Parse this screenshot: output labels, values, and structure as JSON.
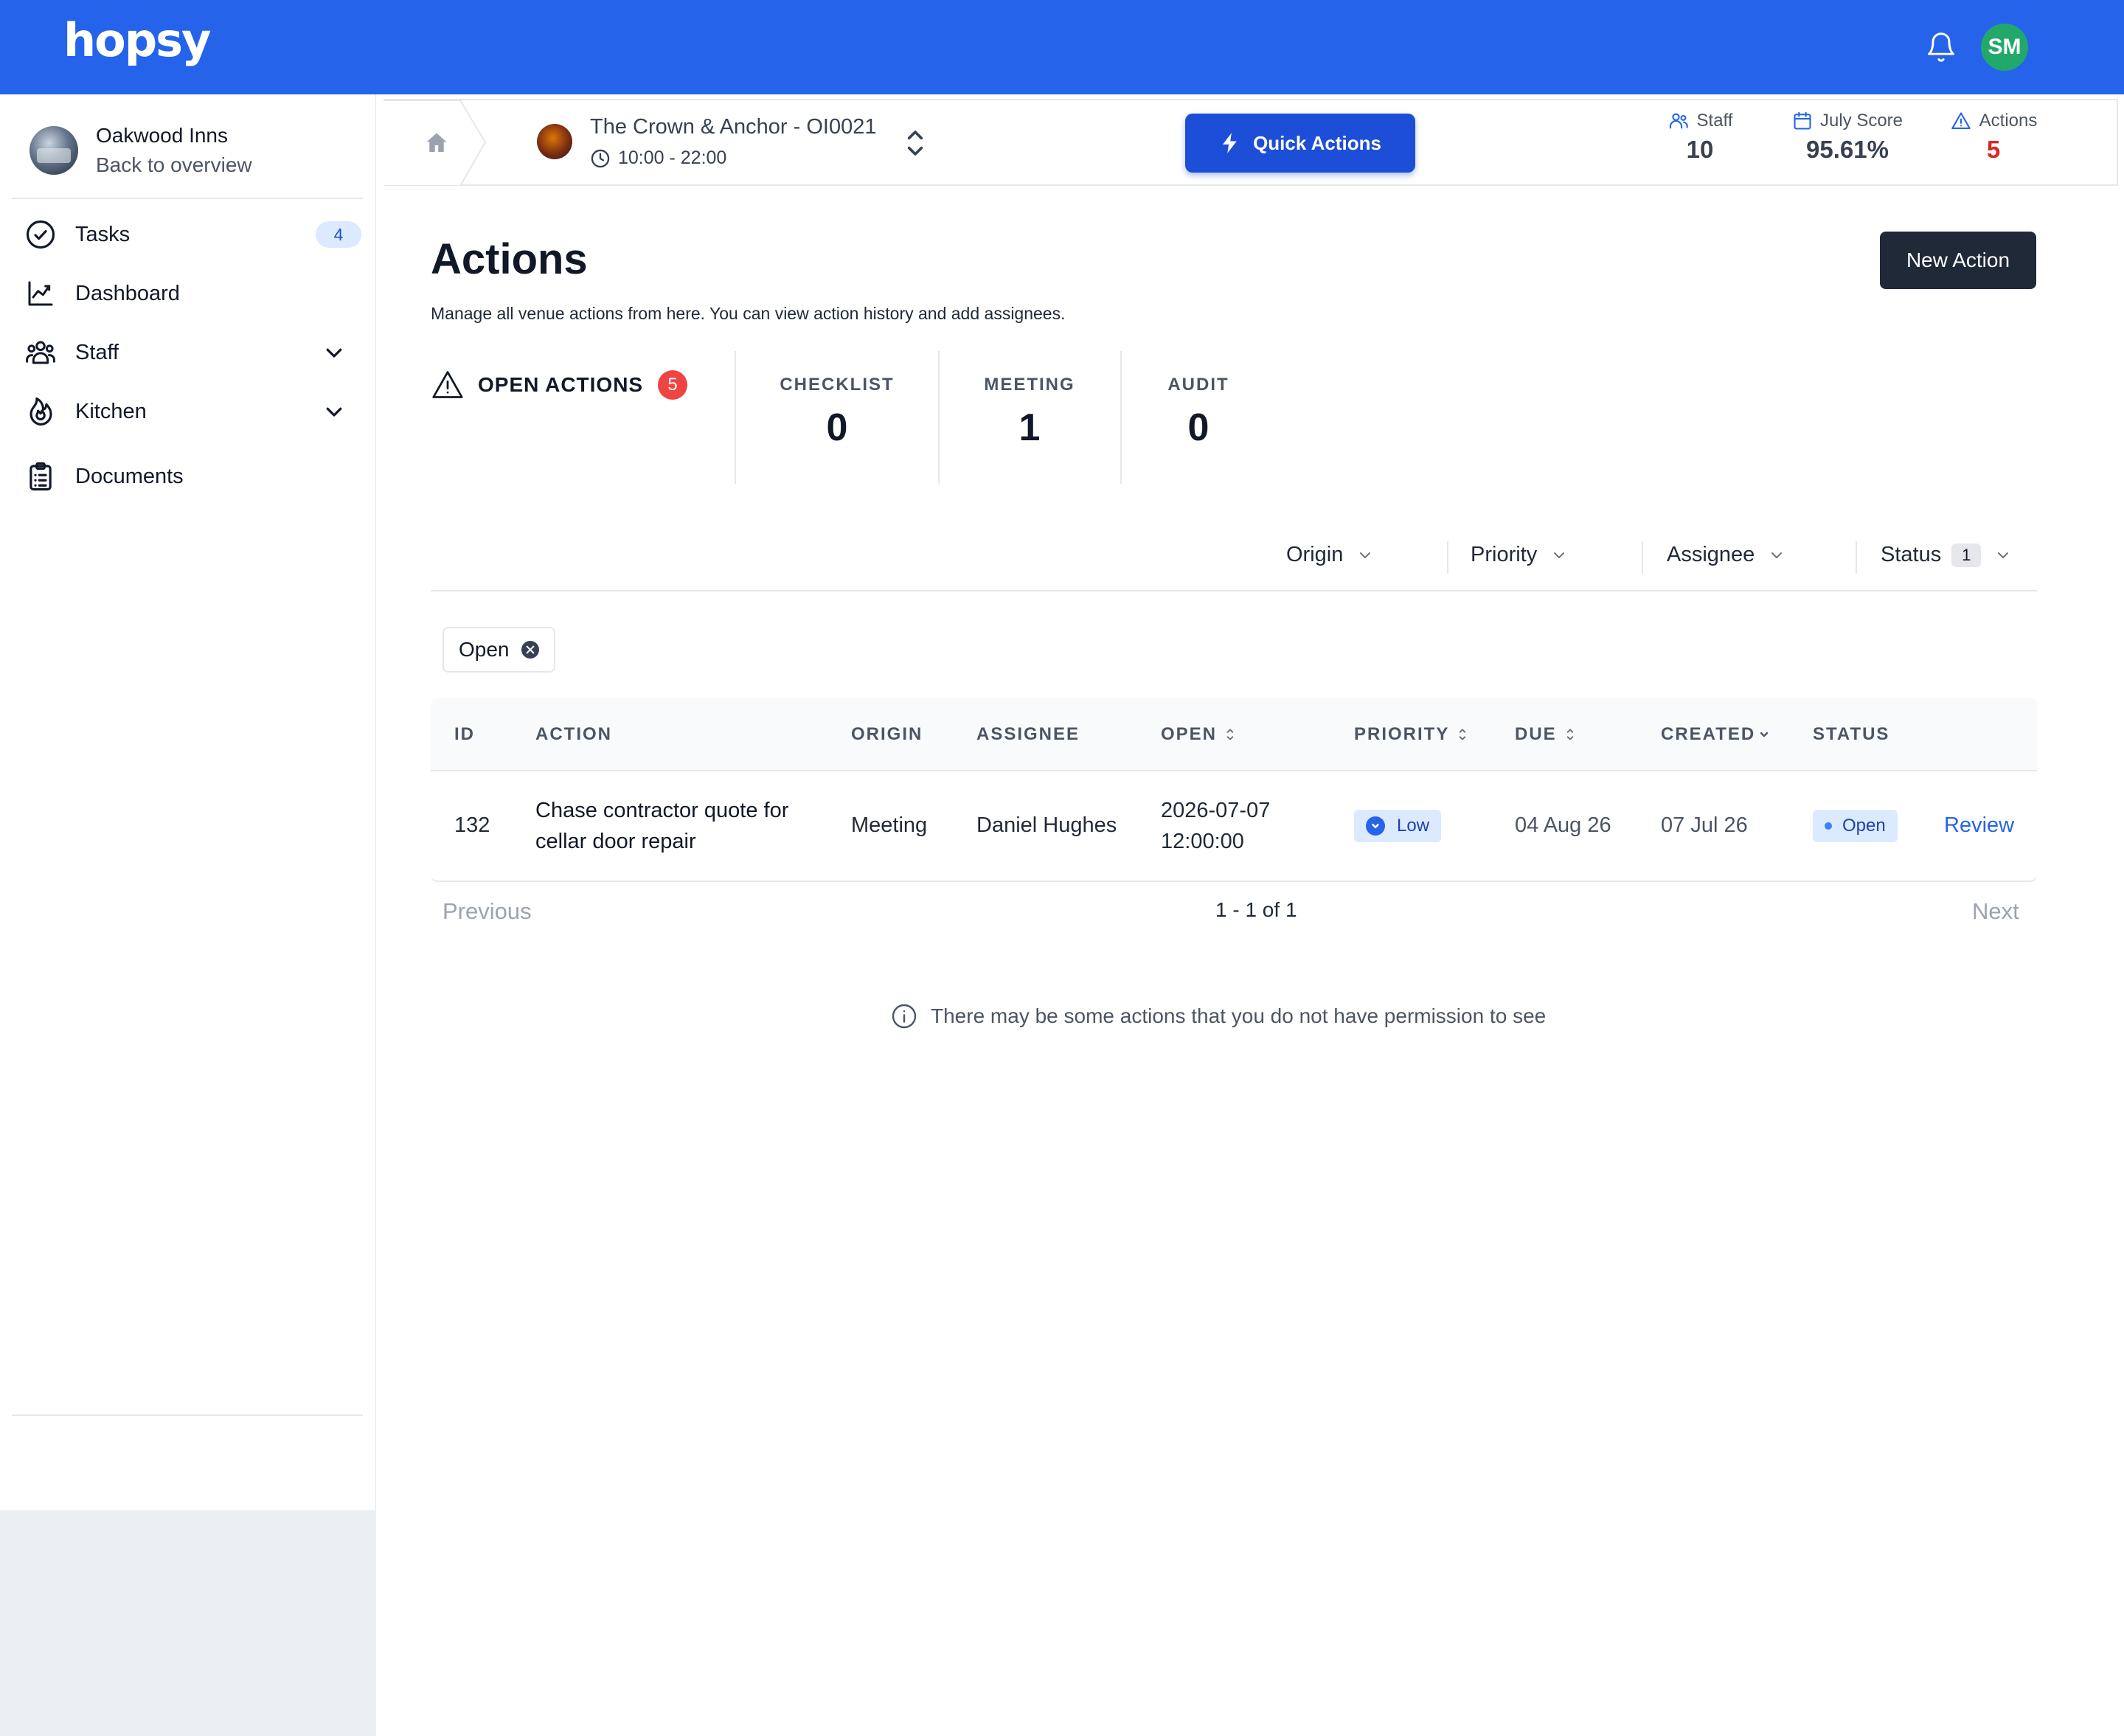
{
  "app": {
    "logo": "hopsy",
    "user_initials": "SM"
  },
  "sidebar": {
    "org_name": "Oakwood Inns",
    "back_link": "Back to overview",
    "items": [
      {
        "label": "Tasks",
        "icon": "check-circle-icon",
        "badge": "4"
      },
      {
        "label": "Dashboard",
        "icon": "chart-line-icon"
      },
      {
        "label": "Staff",
        "icon": "users-icon",
        "expandable": true
      },
      {
        "label": "Kitchen",
        "icon": "flame-icon",
        "expandable": true
      },
      {
        "label": "Documents",
        "icon": "clipboard-icon"
      }
    ]
  },
  "venue": {
    "name": "The Crown & Anchor - OI0021",
    "hours": "10:00 - 22:00",
    "quick_actions_label": "Quick Actions"
  },
  "header_stats": [
    {
      "label": "Staff",
      "value": "10",
      "icon": "users-icon"
    },
    {
      "label": "July Score",
      "value": "95.61%",
      "icon": "calendar-icon"
    },
    {
      "label": "Actions",
      "value": "5",
      "icon": "warning-icon",
      "color": "#dc2626"
    }
  ],
  "page": {
    "title": "Actions",
    "subtitle": "Manage all venue actions from here. You can view action history and add assignees.",
    "new_button": "New Action"
  },
  "summary": {
    "open_label": "OPEN ACTIONS",
    "open_count": "5",
    "counts": [
      {
        "label": "CHECKLIST",
        "value": "0"
      },
      {
        "label": "MEETING",
        "value": "1"
      },
      {
        "label": "AUDIT",
        "value": "0"
      }
    ]
  },
  "filters": {
    "origin": "Origin",
    "priority": "Priority",
    "assignee": "Assignee",
    "status": "Status",
    "status_count": "1",
    "active_chip": "Open"
  },
  "table": {
    "columns": [
      "ID",
      "ACTION",
      "ORIGIN",
      "ASSIGNEE",
      "OPEN",
      "PRIORITY",
      "DUE",
      "CREATED",
      "STATUS"
    ],
    "rows": [
      {
        "id": "132",
        "action_line1": "Chase contractor quote for",
        "action_line2": "cellar door repair",
        "origin": "Meeting",
        "assignee": "Daniel Hughes",
        "open_date": "2026-07-07",
        "open_time": "12:00:00",
        "priority": "Low",
        "due": "04 Aug 26",
        "created": "07 Jul 26",
        "status": "Open",
        "link": "Review"
      }
    ]
  },
  "pagination": {
    "previous": "Previous",
    "range": "1 - 1 of 1",
    "next": "Next"
  },
  "note": "There may be some actions that you do not have permission to see",
  "colors": {
    "brand": "#2563eb",
    "primary_button": "#1d4ed8",
    "dark_button": "#1f2937",
    "alert": "#ef4444"
  }
}
